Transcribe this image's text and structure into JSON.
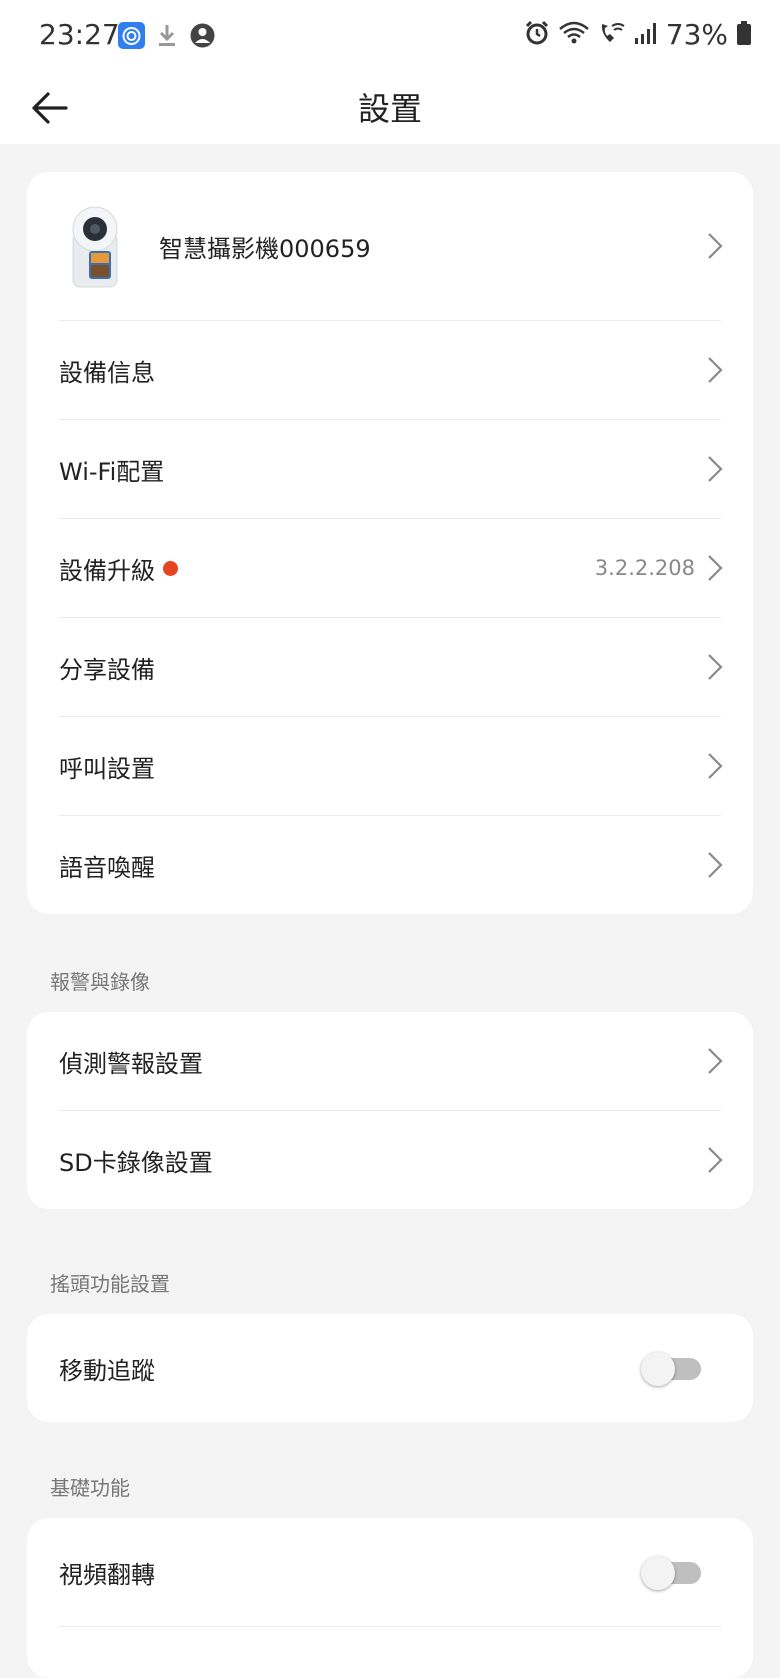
{
  "status_bar": {
    "time": "23:27",
    "battery": "73%",
    "icons_left": [
      "app-notification-icon",
      "download-icon",
      "account-icon"
    ],
    "icons_right": [
      "alarm-icon",
      "wifi-icon",
      "wifi-call-icon",
      "signal-icon",
      "battery-icon"
    ]
  },
  "app_bar": {
    "title": "設置",
    "back_icon": "back-arrow-icon"
  },
  "device_card": {
    "device_name": "智慧攝影機000659",
    "items": [
      {
        "label": "設備信息"
      },
      {
        "label": "Wi-Fi配置"
      },
      {
        "label": "設備升級",
        "value": "3.2.2.208",
        "badge": "red-dot"
      },
      {
        "label": "分享設備"
      },
      {
        "label": "呼叫設置"
      },
      {
        "label": "語音喚醒"
      }
    ]
  },
  "alarm_section": {
    "title": "報警與錄像",
    "items": [
      {
        "label": "偵測警報設置"
      },
      {
        "label": "SD卡錄像設置"
      }
    ]
  },
  "ptz_section": {
    "title": "搖頭功能設置",
    "items": [
      {
        "label": "移動追蹤",
        "toggle": false
      }
    ]
  },
  "basic_section": {
    "title": "基礎功能",
    "items": [
      {
        "label": "視頻翻轉",
        "toggle": false
      }
    ]
  },
  "colors": {
    "background": "#f4f4f4",
    "card": "#ffffff",
    "badge": "#e8431f",
    "toggle_off_track": "#bfbfbf"
  }
}
